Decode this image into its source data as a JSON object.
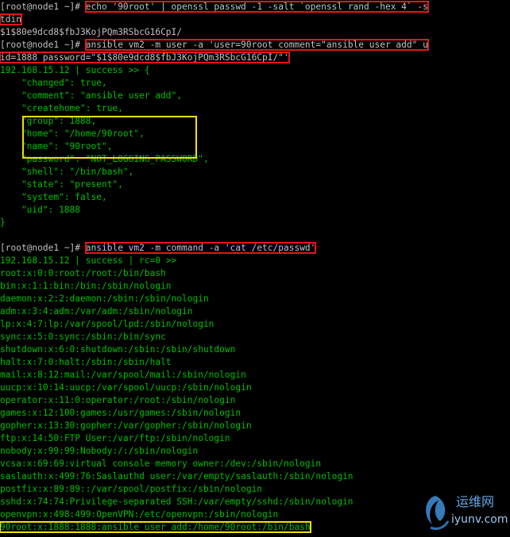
{
  "terminal": {
    "lines": [
      {
        "segments": [
          {
            "t": "[root@node1 ~]# ",
            "c": "w"
          },
          {
            "t": "echo '90root' | openssl passwd -1 -salt `openssl rand -hex 4` -s",
            "c": "w",
            "box": "red"
          }
        ]
      },
      {
        "segments": [
          {
            "t": "tdin",
            "c": "w",
            "box": "red"
          }
        ]
      },
      {
        "segments": [
          {
            "t": "$1$80e9dcd8$fbJ3KojPQm3RSbcG16CpI/",
            "c": "w"
          }
        ]
      },
      {
        "segments": [
          {
            "t": "[root@node1 ~]# ",
            "c": "w"
          },
          {
            "t": "ansible vm2 -m user -a 'user=90root comment=\"ansible user add\" u",
            "c": "w",
            "box": "red"
          }
        ]
      },
      {
        "segments": [
          {
            "t": "id=1888 password=\"$1$80e9dcd8$fbJ3KojPQm3RSbcG16CpI/\"'",
            "c": "w",
            "box": "red"
          }
        ]
      },
      {
        "segments": [
          {
            "t": "192.168.15.12 | success >> {",
            "c": "g"
          }
        ]
      },
      {
        "segments": [
          {
            "t": "    \"changed\": true,",
            "c": "g"
          }
        ]
      },
      {
        "segments": [
          {
            "t": "    \"comment\": \"ansible user add\",",
            "c": "g"
          }
        ]
      },
      {
        "segments": [
          {
            "t": "    \"createhome\": true,",
            "c": "g"
          }
        ]
      },
      {
        "segments": [
          {
            "t": "    \"group\": 1888,",
            "c": "g"
          }
        ]
      },
      {
        "segments": [
          {
            "t": "    \"home\": \"/home/90root\",",
            "c": "g"
          }
        ]
      },
      {
        "segments": [
          {
            "t": "    \"name\": \"90root\",",
            "c": "g"
          }
        ]
      },
      {
        "segments": [
          {
            "t": "    \"password\": \"NOT_LOGGING_PASSWORD\",",
            "c": "g"
          }
        ]
      },
      {
        "segments": [
          {
            "t": "    \"shell\": \"/bin/bash\",",
            "c": "g"
          }
        ]
      },
      {
        "segments": [
          {
            "t": "    \"state\": \"present\",",
            "c": "g"
          }
        ]
      },
      {
        "segments": [
          {
            "t": "    \"system\": false,",
            "c": "g"
          }
        ]
      },
      {
        "segments": [
          {
            "t": "    \"uid\": 1888",
            "c": "g"
          }
        ]
      },
      {
        "segments": [
          {
            "t": "}",
            "c": "g"
          }
        ]
      },
      {
        "segments": [
          {
            "t": "",
            "c": "w"
          }
        ]
      },
      {
        "segments": [
          {
            "t": "[root@node1 ~]# ",
            "c": "w"
          },
          {
            "t": "ansible vm2 -m command -a 'cat /etc/passwd'",
            "c": "w",
            "box": "red"
          }
        ]
      },
      {
        "segments": [
          {
            "t": "192.168.15.12 | success | rc=0 >>",
            "c": "g"
          }
        ]
      },
      {
        "segments": [
          {
            "t": "root:x:0:0:root:/root:/bin/bash",
            "c": "g"
          }
        ]
      },
      {
        "segments": [
          {
            "t": "bin:x:1:1:bin:/bin:/sbin/nologin",
            "c": "g"
          }
        ]
      },
      {
        "segments": [
          {
            "t": "daemon:x:2:2:daemon:/sbin:/sbin/nologin",
            "c": "g"
          }
        ]
      },
      {
        "segments": [
          {
            "t": "adm:x:3:4:adm:/var/adm:/sbin/nologin",
            "c": "g"
          }
        ]
      },
      {
        "segments": [
          {
            "t": "lp:x:4:7:lp:/var/spool/lpd:/sbin/nologin",
            "c": "g"
          }
        ]
      },
      {
        "segments": [
          {
            "t": "sync:x:5:0:sync:/sbin:/bin/sync",
            "c": "g"
          }
        ]
      },
      {
        "segments": [
          {
            "t": "shutdown:x:6:0:shutdown:/sbin:/sbin/shutdown",
            "c": "g"
          }
        ]
      },
      {
        "segments": [
          {
            "t": "halt:x:7:0:halt:/sbin:/sbin/halt",
            "c": "g"
          }
        ]
      },
      {
        "segments": [
          {
            "t": "mail:x:8:12:mail:/var/spool/mail:/sbin/nologin",
            "c": "g"
          }
        ]
      },
      {
        "segments": [
          {
            "t": "uucp:x:10:14:uucp:/var/spool/uucp:/sbin/nologin",
            "c": "g"
          }
        ]
      },
      {
        "segments": [
          {
            "t": "operator:x:11:0:operator:/root:/sbin/nologin",
            "c": "g"
          }
        ]
      },
      {
        "segments": [
          {
            "t": "games:x:12:100:games:/usr/games:/sbin/nologin",
            "c": "g"
          }
        ]
      },
      {
        "segments": [
          {
            "t": "gopher:x:13:30:gopher:/var/gopher:/sbin/nologin",
            "c": "g"
          }
        ]
      },
      {
        "segments": [
          {
            "t": "ftp:x:14:50:FTP User:/var/ftp:/sbin/nologin",
            "c": "g"
          }
        ]
      },
      {
        "segments": [
          {
            "t": "nobody:x:99:99:Nobody:/:/sbin/nologin",
            "c": "g"
          }
        ]
      },
      {
        "segments": [
          {
            "t": "vcsa:x:69:69:virtual console memory owner:/dev:/sbin/nologin",
            "c": "g"
          }
        ]
      },
      {
        "segments": [
          {
            "t": "saslauth:x:499:76:Saslauthd user:/var/empty/saslauth:/sbin/nologin",
            "c": "g"
          }
        ]
      },
      {
        "segments": [
          {
            "t": "postfix:x:89:89::/var/spool/postfix:/sbin/nologin",
            "c": "g"
          }
        ]
      },
      {
        "segments": [
          {
            "t": "sshd:x:74:74:Privilege-separated SSH:/var/empty/sshd:/sbin/nologin",
            "c": "g"
          }
        ]
      },
      {
        "segments": [
          {
            "t": "openvpn:x:498:499:OpenVPN:/etc/openvpn:/sbin/nologin",
            "c": "g"
          }
        ]
      },
      {
        "segments": [
          {
            "t": "90root:x:1888:1888:ansible user add:/home/90root:/bin/bash",
            "c": "g",
            "box": "yellow"
          }
        ]
      }
    ]
  },
  "colors": {
    "background": "#000000",
    "prompt_text": "#c0c0c0",
    "output_text": "#00c000",
    "highlight_red": "#e01818",
    "highlight_yellow": "#f0e000"
  },
  "watermark": {
    "line1": "运维网",
    "line2": "iyunv.com",
    "icon": "swirl-logo-icon"
  }
}
